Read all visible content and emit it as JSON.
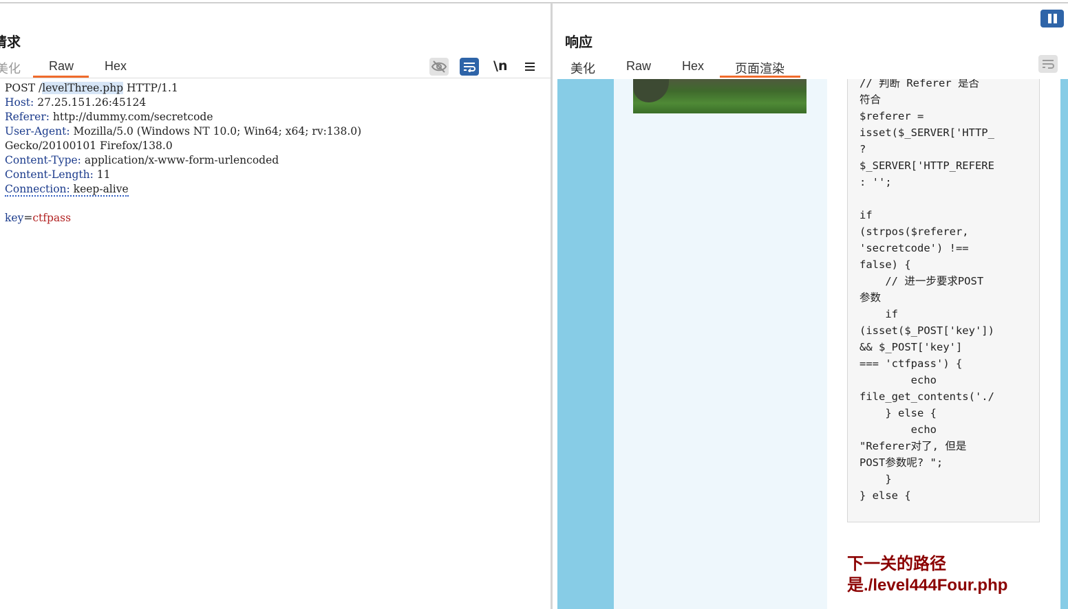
{
  "request": {
    "title": "请求",
    "tabs": [
      "美化",
      "Raw",
      "Hex"
    ],
    "active_tab": "Raw",
    "newline_toggle": "\\n",
    "method": "POST /",
    "path": "levelThree.php",
    "protocol": " HTTP/1.1",
    "headers": [
      {
        "name": "Host",
        "value": "27.25.151.26:45124"
      },
      {
        "name": "Referer",
        "value": "http://dummy.com/secretcode"
      },
      {
        "name": "User-Agent",
        "value": "Mozilla/5.0 (Windows NT 10.0; Win64; x64; rv:138.0)"
      },
      {
        "name": "",
        "value": "Gecko/20100101 Firefox/138.0"
      },
      {
        "name": "Content-Type",
        "value": "application/x-www-form-urlencoded"
      },
      {
        "name": "Content-Length",
        "value": "11"
      },
      {
        "name": "Connection",
        "value": "keep-alive"
      }
    ],
    "body_key": "key",
    "body_eq": "=",
    "body_value": "ctfpass"
  },
  "response": {
    "title": "响应",
    "tabs": [
      "美化",
      "Raw",
      "Hex",
      "页面渲染"
    ],
    "active_tab": "页面渲染",
    "code_lines": [
      "// 判断 Referer 是否",
      "符合",
      "$referer =",
      "isset($_SERVER['HTTP_",
      "?",
      "$_SERVER['HTTP_REFERE",
      ": '';",
      "",
      "if",
      "(strpos($referer,",
      "'secretcode') !==",
      "false) {",
      "    // 进一步要求POST",
      "参数",
      "    if",
      "(isset($_POST['key'])",
      "&& $_POST['key']",
      "=== 'ctfpass') {",
      "        echo",
      "file_get_contents('./",
      "    } else {",
      "        echo",
      "\"Referer对了, 但是",
      "POST参数呢? \";",
      "    }",
      "} else {"
    ],
    "next_path_line1": "下一关的路径",
    "next_path_line2": "是./level444Four.php"
  },
  "colors": {
    "accent_tab": "#f06b2c",
    "button_blue": "#2e64a8",
    "header_name": "#1b3b8c",
    "body_value": "#b22222",
    "next_path": "#8b0000",
    "render_side": "#87cce6"
  },
  "icons": [
    "eye-off-icon",
    "word-wrap-icon",
    "menu-icon",
    "pause-icon",
    "word-wrap-icon"
  ]
}
